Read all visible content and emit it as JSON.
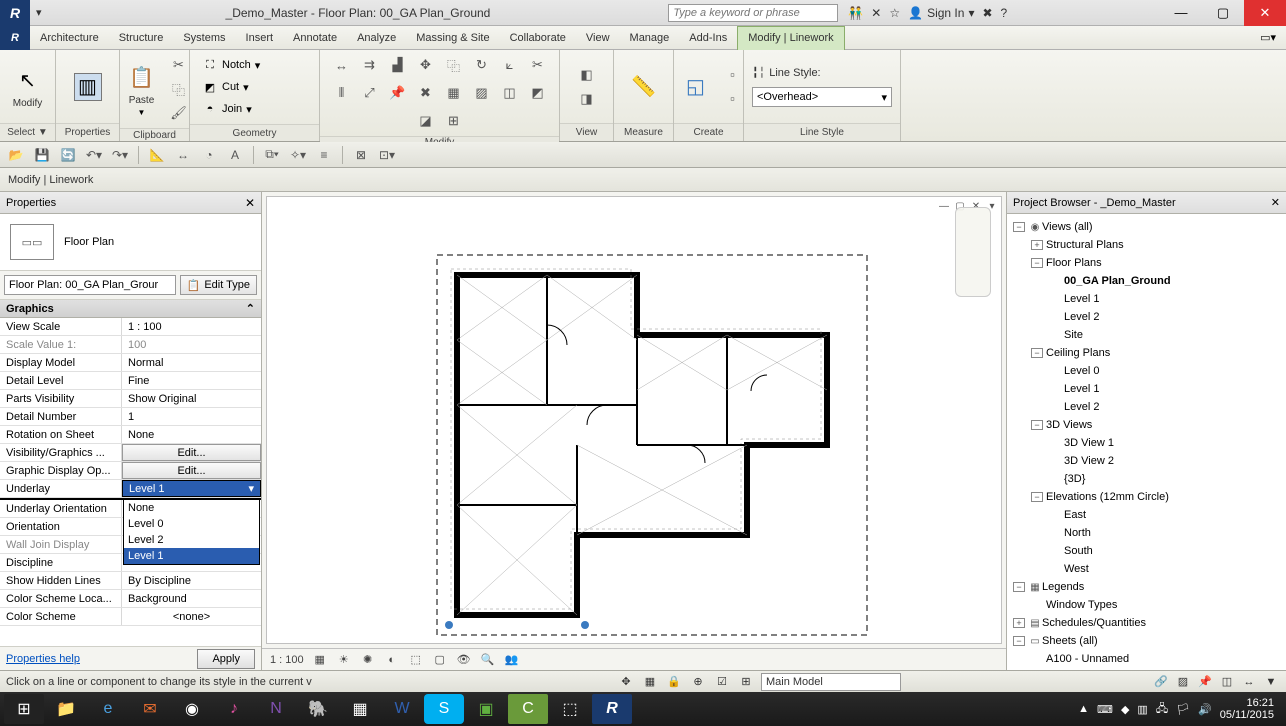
{
  "title": "_Demo_Master - Floor Plan: 00_GA Plan_Ground",
  "searchPlaceholder": "Type a keyword or phrase",
  "signin": "Sign In",
  "menus": [
    "Architecture",
    "Structure",
    "Systems",
    "Insert",
    "Annotate",
    "Analyze",
    "Massing & Site",
    "Collaborate",
    "View",
    "Manage",
    "Add-Ins",
    "Modify | Linework"
  ],
  "activeMenu": "Modify | Linework",
  "ribbon": {
    "select": {
      "modify": "Modify",
      "title": "Select ▼"
    },
    "properties": {
      "btn": "Properties",
      "title": "Properties"
    },
    "clipboard": {
      "paste": "Paste",
      "title": "Clipboard"
    },
    "geometry": {
      "notch": "Notch",
      "cut": "Cut",
      "join": "Join",
      "title": "Geometry"
    },
    "modify": {
      "title": "Modify"
    },
    "view": {
      "title": "View"
    },
    "measure": {
      "title": "Measure"
    },
    "create": {
      "title": "Create"
    },
    "linestyle": {
      "label": "Line Style:",
      "value": "<Overhead>",
      "title": "Line Style"
    }
  },
  "contextbar": "Modify | Linework",
  "properties": {
    "header": "Properties",
    "type": "Floor Plan",
    "selector": "Floor Plan: 00_GA Plan_Grour",
    "editType": "Edit Type",
    "category": "Graphics",
    "rows": [
      {
        "k": "View Scale",
        "v": "1 : 100"
      },
      {
        "k": "Scale Value    1:",
        "v": "100",
        "gray": true
      },
      {
        "k": "Display Model",
        "v": "Normal"
      },
      {
        "k": "Detail Level",
        "v": "Fine"
      },
      {
        "k": "Parts Visibility",
        "v": "Show Original"
      },
      {
        "k": "Detail Number",
        "v": "1"
      },
      {
        "k": "Rotation on Sheet",
        "v": "None"
      },
      {
        "k": "Visibility/Graphics ...",
        "edit": "Edit..."
      },
      {
        "k": "Graphic Display Op...",
        "edit": "Edit..."
      },
      {
        "k": "Underlay",
        "v": "Level 1",
        "selected": true,
        "dropdown": [
          "None",
          "Level 0",
          "Level 2",
          "Level 1"
        ]
      },
      {
        "k": "Underlay Orientation",
        "v": ""
      },
      {
        "k": "Orientation",
        "v": ""
      },
      {
        "k": "Wall Join Display",
        "v": "",
        "kgray": true
      },
      {
        "k": "Discipline",
        "v": ""
      },
      {
        "k": "Show Hidden Lines",
        "v": "By Discipline"
      },
      {
        "k": "Color Scheme Loca...",
        "v": "Background"
      },
      {
        "k": "Color Scheme",
        "v": "<none>",
        "center": true
      }
    ],
    "help": "Properties help",
    "apply": "Apply"
  },
  "canvas": {
    "scale": "1 : 100"
  },
  "browser": {
    "header": "Project Browser - _Demo_Master",
    "tree": [
      {
        "d": 0,
        "tw": "-",
        "ic": "◉",
        "t": "Views (all)"
      },
      {
        "d": 1,
        "tw": "+",
        "t": "Structural Plans"
      },
      {
        "d": 1,
        "tw": "-",
        "t": "Floor Plans"
      },
      {
        "d": 2,
        "t": "00_GA Plan_Ground",
        "bold": true
      },
      {
        "d": 2,
        "t": "Level 1"
      },
      {
        "d": 2,
        "t": "Level 2"
      },
      {
        "d": 2,
        "t": "Site"
      },
      {
        "d": 1,
        "tw": "-",
        "t": "Ceiling Plans"
      },
      {
        "d": 2,
        "t": "Level 0"
      },
      {
        "d": 2,
        "t": "Level 1"
      },
      {
        "d": 2,
        "t": "Level 2"
      },
      {
        "d": 1,
        "tw": "-",
        "t": "3D Views"
      },
      {
        "d": 2,
        "t": "3D View 1"
      },
      {
        "d": 2,
        "t": "3D View 2"
      },
      {
        "d": 2,
        "t": "{3D}"
      },
      {
        "d": 1,
        "tw": "-",
        "t": "Elevations (12mm Circle)"
      },
      {
        "d": 2,
        "t": "East"
      },
      {
        "d": 2,
        "t": "North"
      },
      {
        "d": 2,
        "t": "South"
      },
      {
        "d": 2,
        "t": "West"
      },
      {
        "d": 0,
        "tw": "-",
        "ic": "▦",
        "t": "Legends"
      },
      {
        "d": 1,
        "t": "Window Types"
      },
      {
        "d": 0,
        "tw": "+",
        "ic": "▤",
        "t": "Schedules/Quantities"
      },
      {
        "d": 0,
        "tw": "-",
        "ic": "▭",
        "t": "Sheets (all)"
      },
      {
        "d": 1,
        "t": "A100 - Unnamed",
        "cut": true
      }
    ]
  },
  "statusHint": "Click on a line or component to change its style in the current v",
  "workset": "Main Model",
  "clock": {
    "time": "16:21",
    "date": "05/11/2015"
  }
}
